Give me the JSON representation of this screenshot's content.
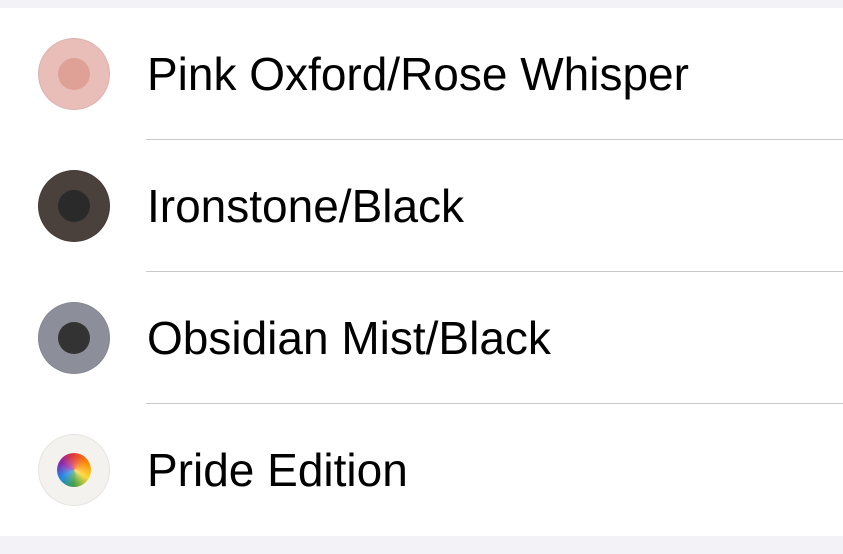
{
  "options": [
    {
      "label": "Pink Oxford/Rose Whisper",
      "outer_color": "#e9bdb8",
      "inner_color": "#dfa096",
      "icon": "pink-oxford-swatch-icon"
    },
    {
      "label": "Ironstone/Black",
      "outer_color": "#4a403c",
      "inner_color": "#2b2a2a",
      "icon": "ironstone-swatch-icon"
    },
    {
      "label": "Obsidian Mist/Black",
      "outer_color": "#8c8f99",
      "inner_color": "#333333",
      "icon": "obsidian-mist-swatch-icon"
    },
    {
      "label": "Pride Edition",
      "outer_color": "#f4f2ef",
      "inner_color": "conic-gradient",
      "icon": "pride-swatch-icon"
    }
  ]
}
